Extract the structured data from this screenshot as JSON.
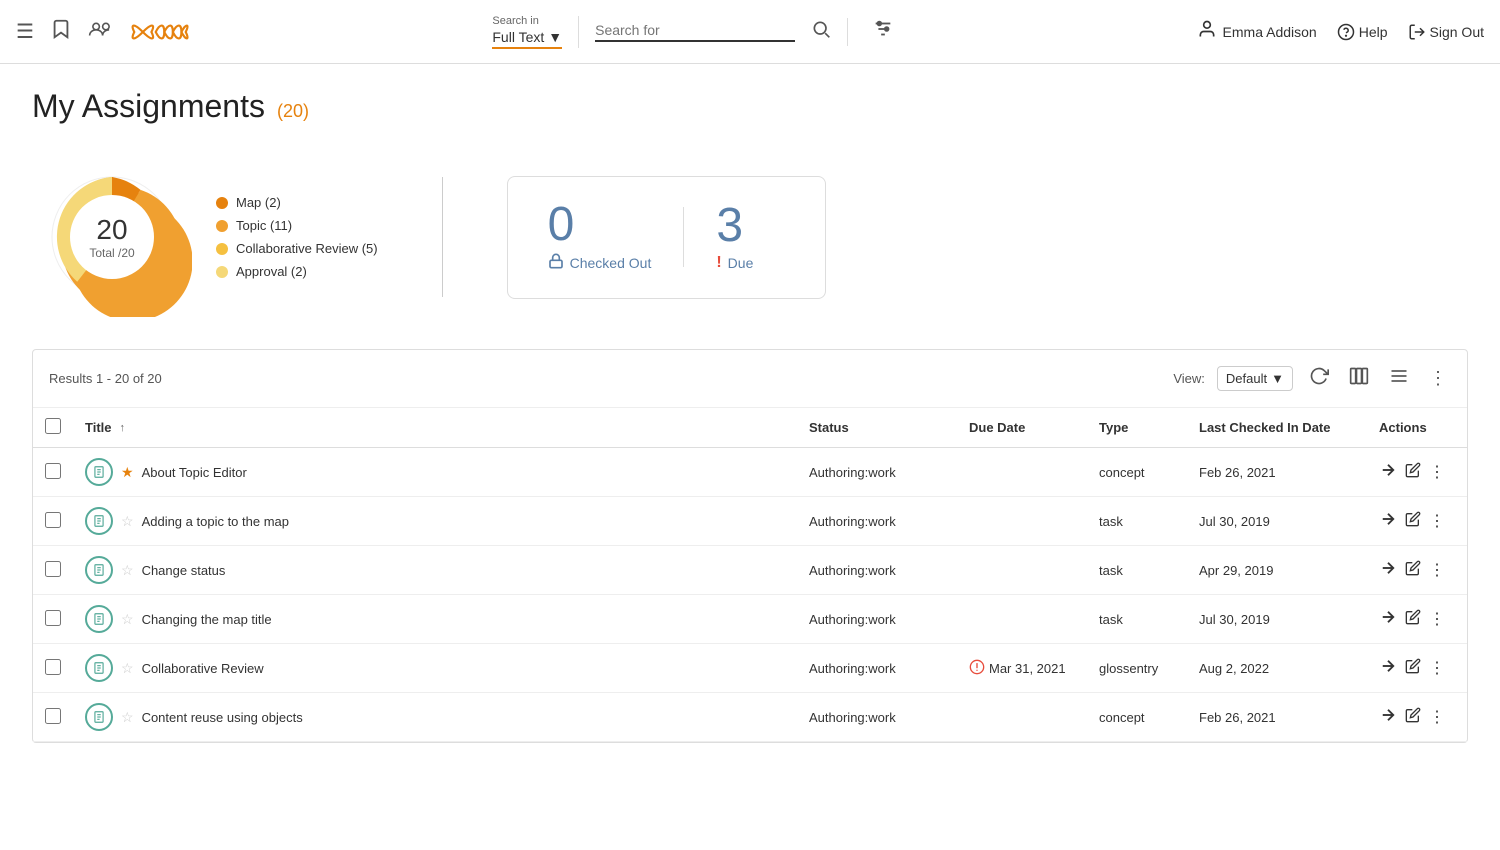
{
  "header": {
    "search_in_label": "Search in",
    "search_in_value": "Full Text",
    "search_placeholder": "Search for",
    "user_name": "Emma Addison",
    "help_label": "Help",
    "signout_label": "Sign Out"
  },
  "page": {
    "title": "My Assignments",
    "count": "(20)"
  },
  "donut": {
    "total_number": "20",
    "total_label": "Total /20",
    "legend": [
      {
        "label": "Map (2)",
        "color": "#e6820e"
      },
      {
        "label": "Topic (11)",
        "color": "#f0a030"
      },
      {
        "label": "Collaborative Review (5)",
        "color": "#f5c040"
      },
      {
        "label": "Approval (2)",
        "color": "#f5d878"
      }
    ]
  },
  "stats": {
    "checked_out_count": "0",
    "checked_out_label": "Checked Out",
    "due_count": "3",
    "due_label": "Due"
  },
  "results": {
    "summary": "Results 1 - 20 of 20",
    "view_label": "View:",
    "view_value": "Default"
  },
  "table": {
    "columns": [
      "Title",
      "Status",
      "Due Date",
      "Type",
      "Last Checked In Date",
      "Actions"
    ],
    "rows": [
      {
        "title": "About Topic Editor",
        "starred": true,
        "status": "Authoring:work",
        "due_date": "",
        "overdue": false,
        "type": "concept",
        "last_checked": "Feb 26, 2021"
      },
      {
        "title": "Adding a topic to the map",
        "starred": false,
        "status": "Authoring:work",
        "due_date": "",
        "overdue": false,
        "type": "task",
        "last_checked": "Jul 30, 2019"
      },
      {
        "title": "Change status",
        "starred": false,
        "status": "Authoring:work",
        "due_date": "",
        "overdue": false,
        "type": "task",
        "last_checked": "Apr 29, 2019"
      },
      {
        "title": "Changing the map title",
        "starred": false,
        "status": "Authoring:work",
        "due_date": "",
        "overdue": false,
        "type": "task",
        "last_checked": "Jul 30, 2019"
      },
      {
        "title": "Collaborative Review",
        "starred": false,
        "status": "Authoring:work",
        "due_date": "Mar 31, 2021",
        "overdue": true,
        "type": "glossentry",
        "last_checked": "Aug 2, 2022"
      },
      {
        "title": "Content reuse using objects",
        "starred": false,
        "status": "Authoring:work",
        "due_date": "",
        "overdue": false,
        "type": "concept",
        "last_checked": "Feb 26, 2021"
      }
    ]
  }
}
